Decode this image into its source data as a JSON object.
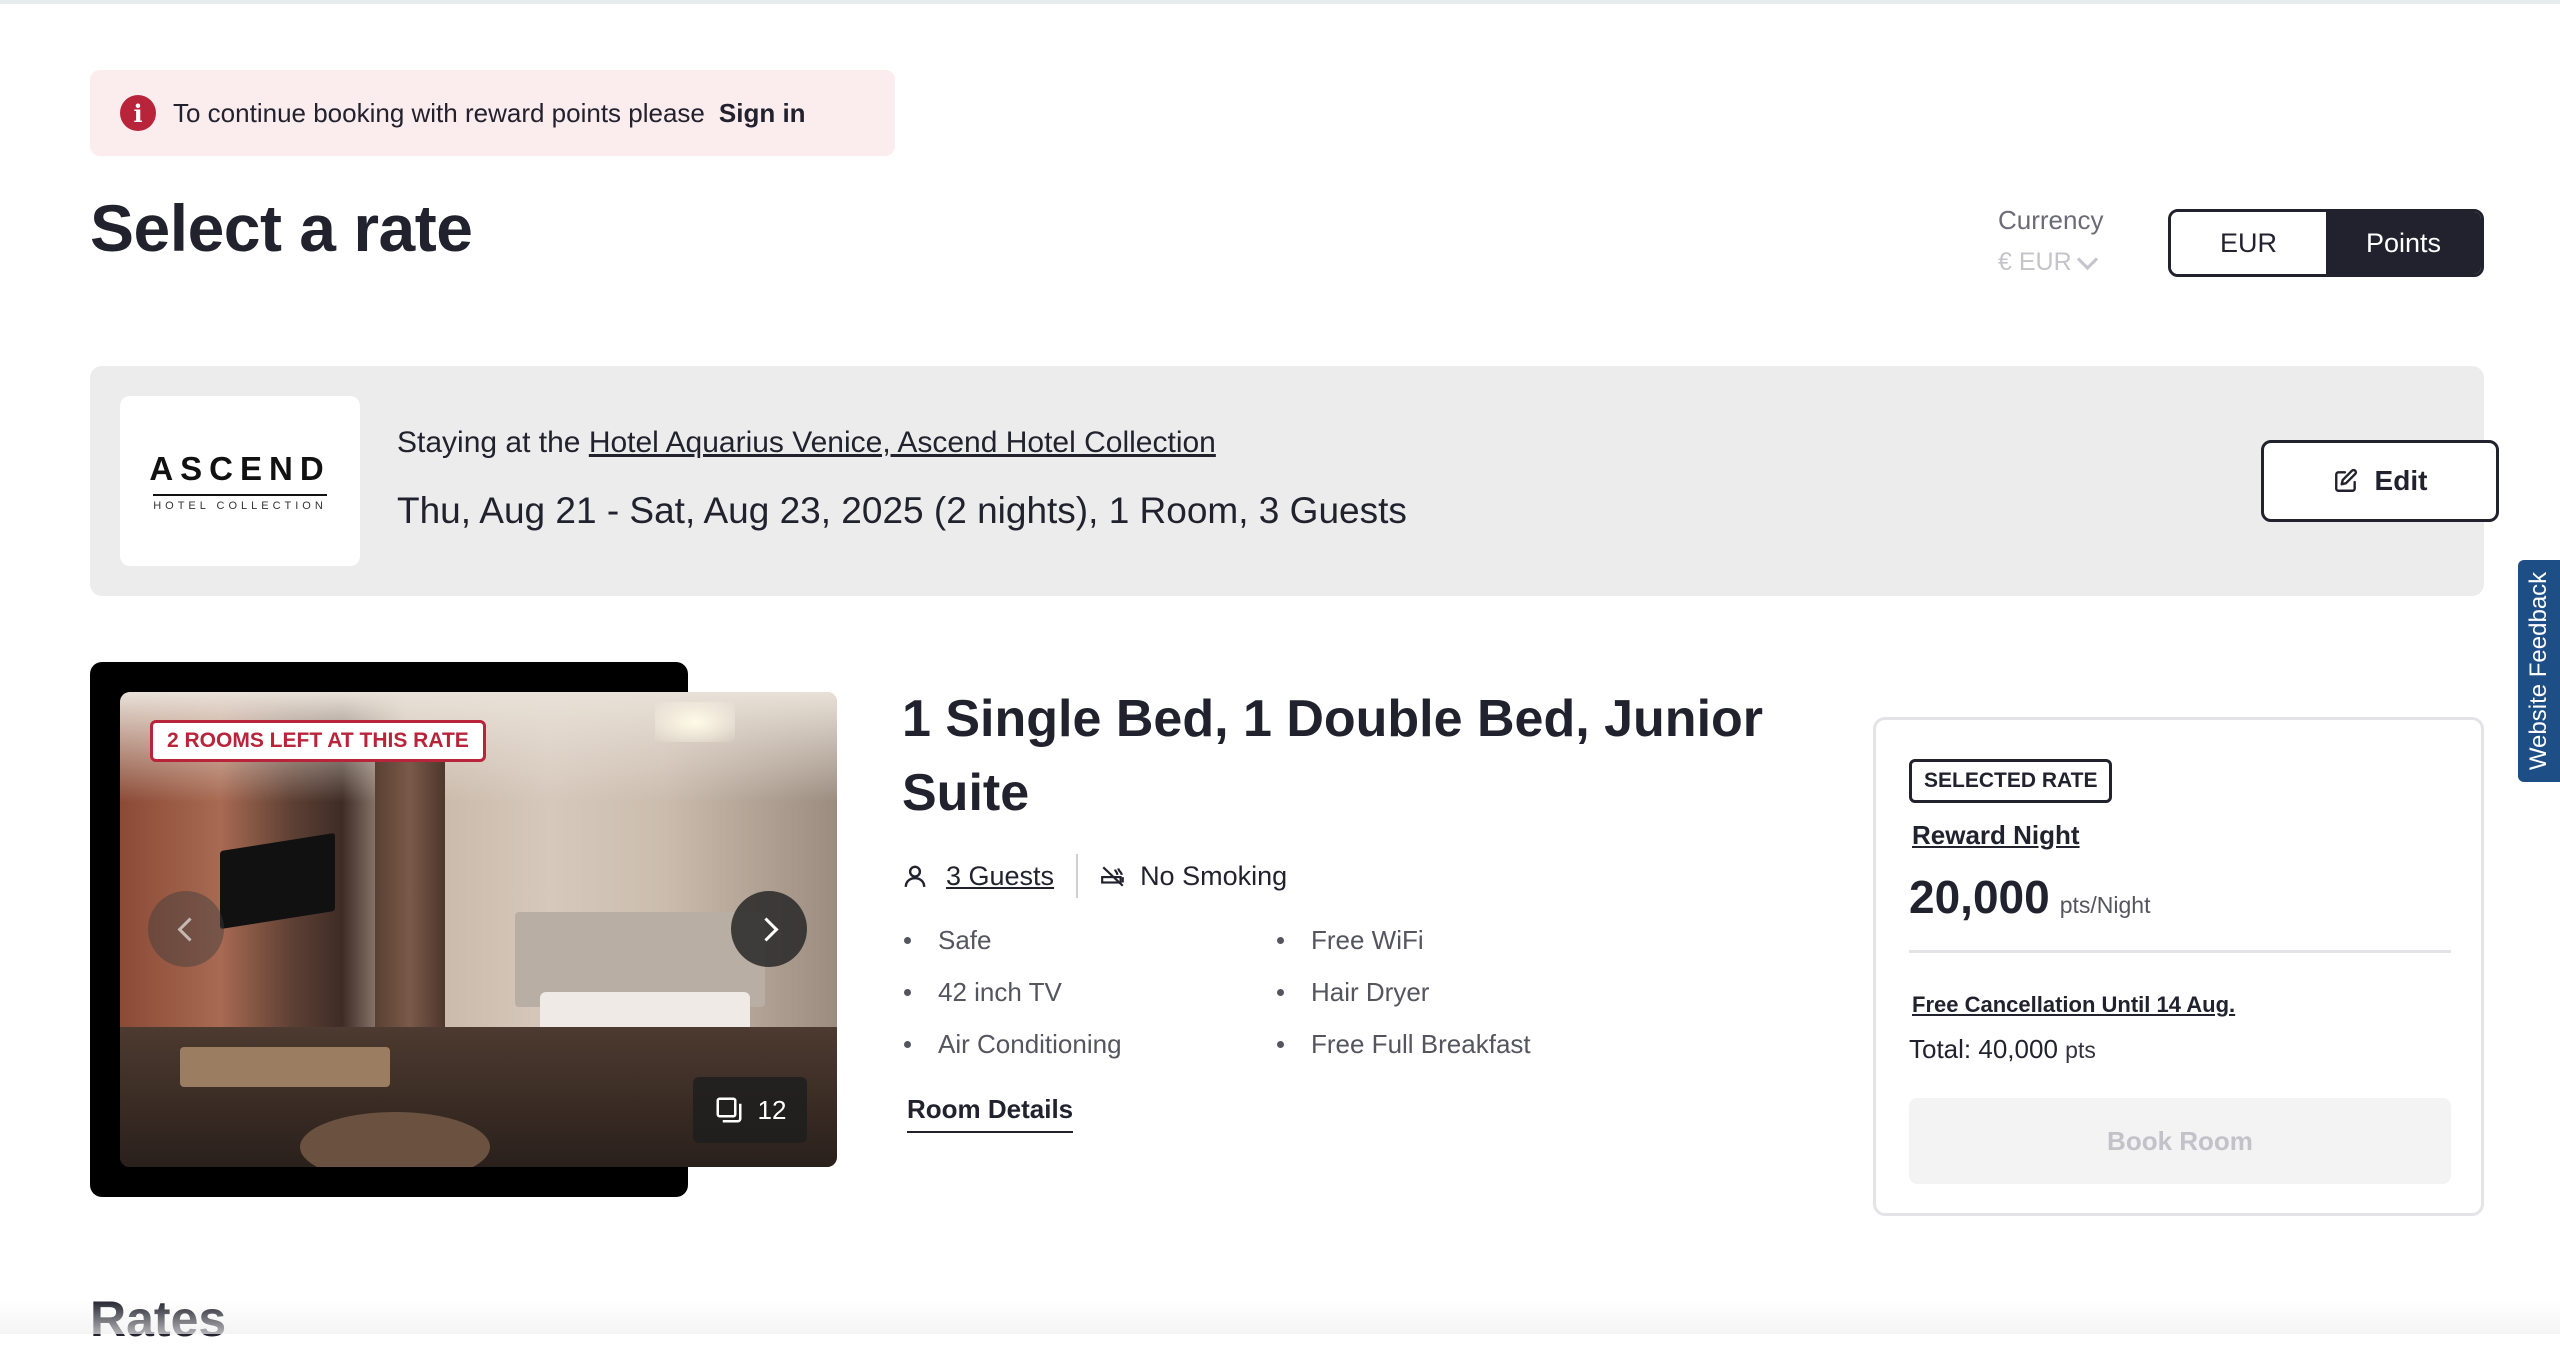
{
  "banner": {
    "text": "To continue booking with reward points please",
    "link": "Sign in"
  },
  "page_title": "Select a rate",
  "currency": {
    "label": "Currency",
    "selected": "€ EUR",
    "options": [
      "EUR",
      "Points"
    ],
    "active": "Points"
  },
  "stay": {
    "logo_main": "ASCEND",
    "logo_sub": "HOTEL COLLECTION",
    "prefix": "Staying at the",
    "hotel_name": "Hotel Aquarius Venice, Ascend Hotel Collection",
    "details": "Thu, Aug 21 - Sat, Aug 23, 2025 (2 nights), 1 Room, 3 Guests",
    "edit_label": "Edit"
  },
  "room": {
    "availability_badge": "2 ROOMS LEFT AT THIS RATE",
    "photo_count": "12",
    "title": "1 Single Bed, 1 Double Bed, Junior Suite",
    "guests": "3 Guests",
    "smoking": "No Smoking",
    "amenities_left": [
      "Safe",
      "42 inch TV",
      "Air Conditioning"
    ],
    "amenities_right": [
      "Free WiFi",
      "Hair Dryer",
      "Free Full Breakfast"
    ],
    "details_link": "Room Details"
  },
  "rate": {
    "badge": "SELECTED RATE",
    "name": "Reward Night",
    "price": "20,000",
    "price_unit": "pts/Night",
    "cancellation": "Free Cancellation Until 14 Aug.",
    "total_label": "Total:",
    "total_value": "40,000",
    "total_unit": "pts",
    "book_label": "Book Room"
  },
  "rates_heading": "Rates",
  "feedback": "Website Feedback",
  "colors": {
    "brand_dark": "#22222e",
    "alert_red": "#b8243a",
    "banner_bg": "#fbecee",
    "feedback_blue": "#1d4f86"
  }
}
